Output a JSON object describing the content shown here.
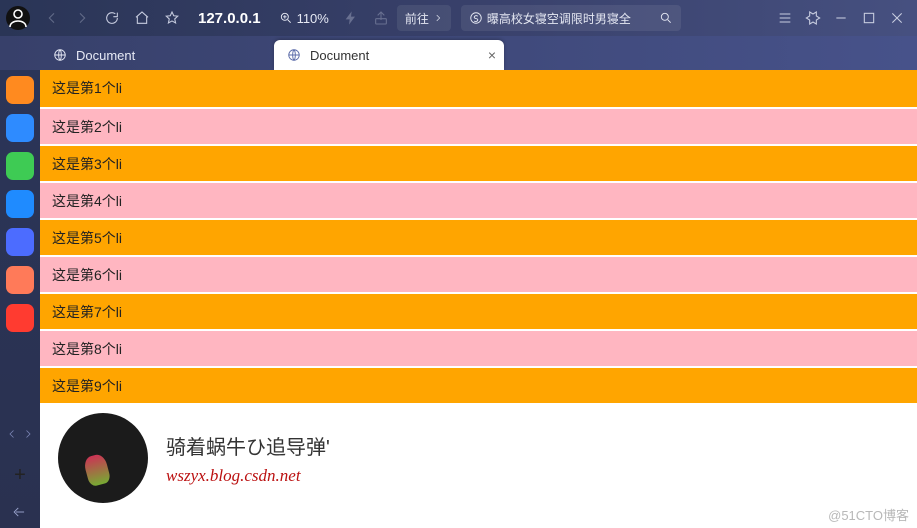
{
  "toolbar": {
    "address": "127.0.0.1",
    "zoom": "110%",
    "goto_label": "前往",
    "search_text": "曝高校女寝空调限时男寝全"
  },
  "tabs": [
    {
      "title": "Document",
      "active": false
    },
    {
      "title": "Document",
      "active": true
    }
  ],
  "list_items": [
    "这是第1个li",
    "这是第2个li",
    "这是第3个li",
    "这是第4个li",
    "这是第5个li",
    "这是第6个li",
    "这是第7个li",
    "这是第8个li",
    "这是第9个li"
  ],
  "author": {
    "nickname": "骑着蜗牛ひ追导弹'",
    "url": "wszyx.blog.csdn.net"
  },
  "watermark": "@51CTO博客",
  "sidebar_colors": [
    "#ff8a1f",
    "#2e8bff",
    "#3ecb54",
    "#1f8bff",
    "#4c6cff",
    "#ff7a59",
    "#ff3b30"
  ]
}
